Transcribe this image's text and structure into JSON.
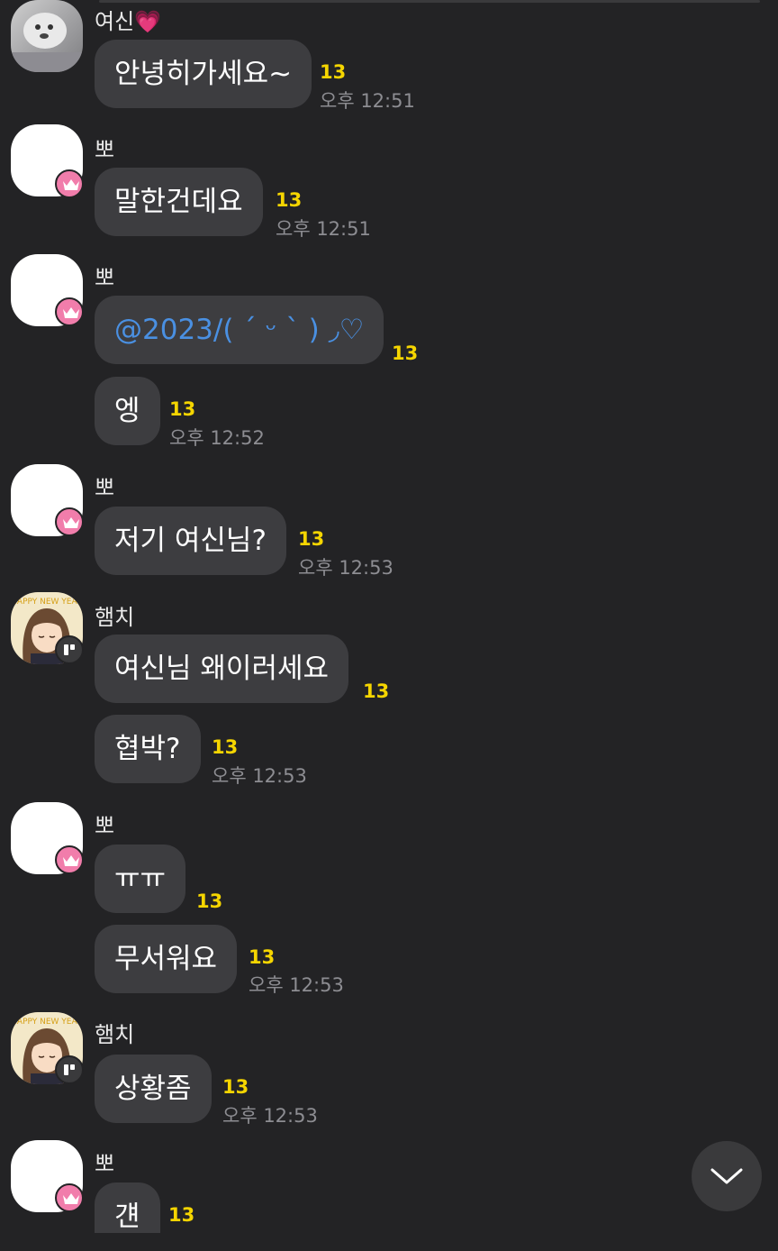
{
  "messages": [
    {
      "sender": "여신💗",
      "text": "안녕히가세요~",
      "unread": "13",
      "time": "오후 12:51"
    },
    {
      "sender": "뽀",
      "text": "말한건데요",
      "unread": "13",
      "time": "오후 12:51"
    },
    {
      "sender": "뽀",
      "text": "@2023/( ˊ ᵕ ˋ ) ◞♡",
      "unread": "13"
    },
    {
      "text": "엥",
      "unread": "13",
      "time": "오후 12:52"
    },
    {
      "sender": "뽀",
      "text": "저기 여신님?",
      "unread": "13",
      "time": "오후 12:53"
    },
    {
      "sender": "햄치",
      "text": "여신님 왜이러세요",
      "unread": "13"
    },
    {
      "text": "협박?",
      "unread": "13",
      "time": "오후 12:53"
    },
    {
      "sender": "뽀",
      "text": "ㅠㅠ",
      "unread": "13"
    },
    {
      "text": "무서워요",
      "unread": "13",
      "time": "오후 12:53"
    },
    {
      "sender": "햄치",
      "text": "상황좀",
      "unread": "13",
      "time": "오후 12:53"
    },
    {
      "sender": "뽀",
      "text": "걘",
      "unread": "13"
    }
  ],
  "avatar_text": {
    "happy_new_year": "HAPPY NEW YEAR"
  },
  "icons": {
    "crown": "crown-badge-icon",
    "profile_badge": "profile-badge-icon",
    "scroll_down": "chevron-down-icon"
  },
  "colors": {
    "background": "#232325",
    "bubble": "#3d3d40",
    "unread": "#f5d500",
    "mention": "#4a90e2",
    "crown_badge": "#f17dab"
  }
}
